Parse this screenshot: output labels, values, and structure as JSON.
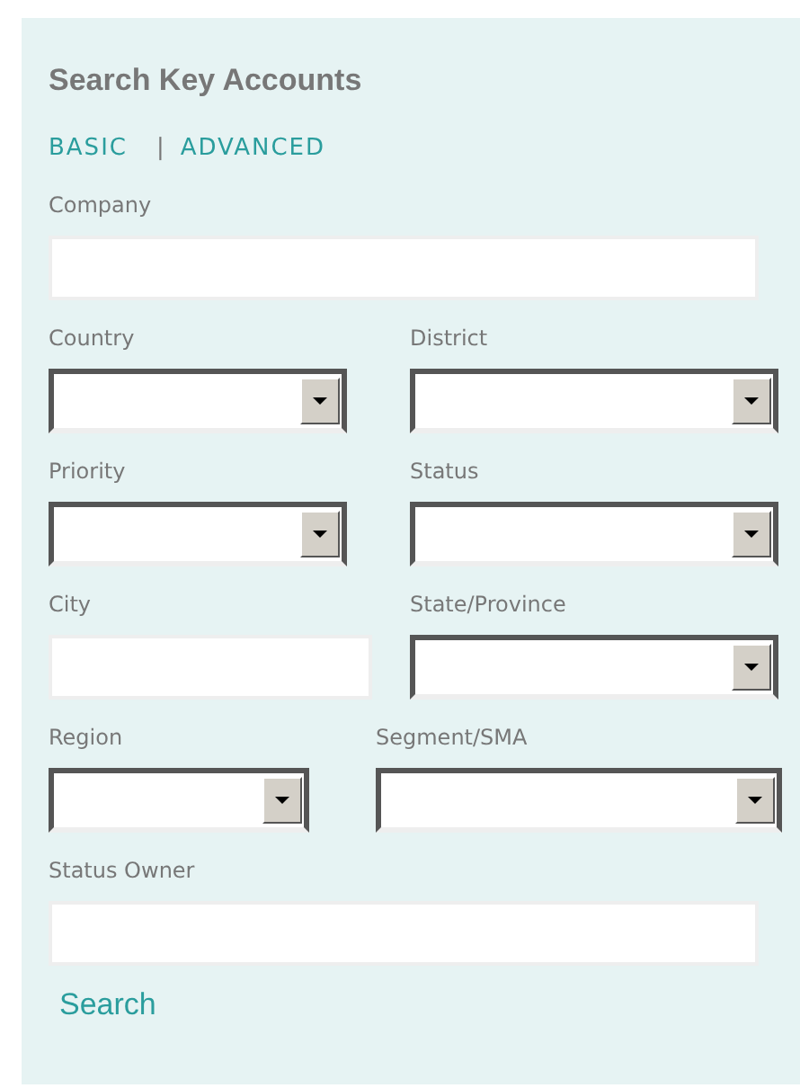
{
  "panel": {
    "title": "Search Key Accounts"
  },
  "tabs": [
    {
      "label": "BASIC"
    },
    {
      "label": "ADVANCED"
    }
  ],
  "tab_separator": "|",
  "rows": [
    [
      {
        "label": "Company",
        "kind": "text"
      }
    ],
    [
      {
        "label": "Country",
        "kind": "select"
      },
      {
        "label": "District",
        "kind": "select"
      }
    ],
    [
      {
        "label": "Priority",
        "kind": "select"
      },
      {
        "label": "Status",
        "kind": "select"
      }
    ],
    [
      {
        "label": "City",
        "kind": "text"
      },
      {
        "label": "State/Province",
        "kind": "select"
      }
    ],
    [
      {
        "label": "Region",
        "kind": "select"
      },
      {
        "label": "Segment/SMA",
        "kind": "select"
      }
    ],
    [
      {
        "label": "Status Owner",
        "kind": "text"
      }
    ]
  ],
  "search_link": "Search"
}
